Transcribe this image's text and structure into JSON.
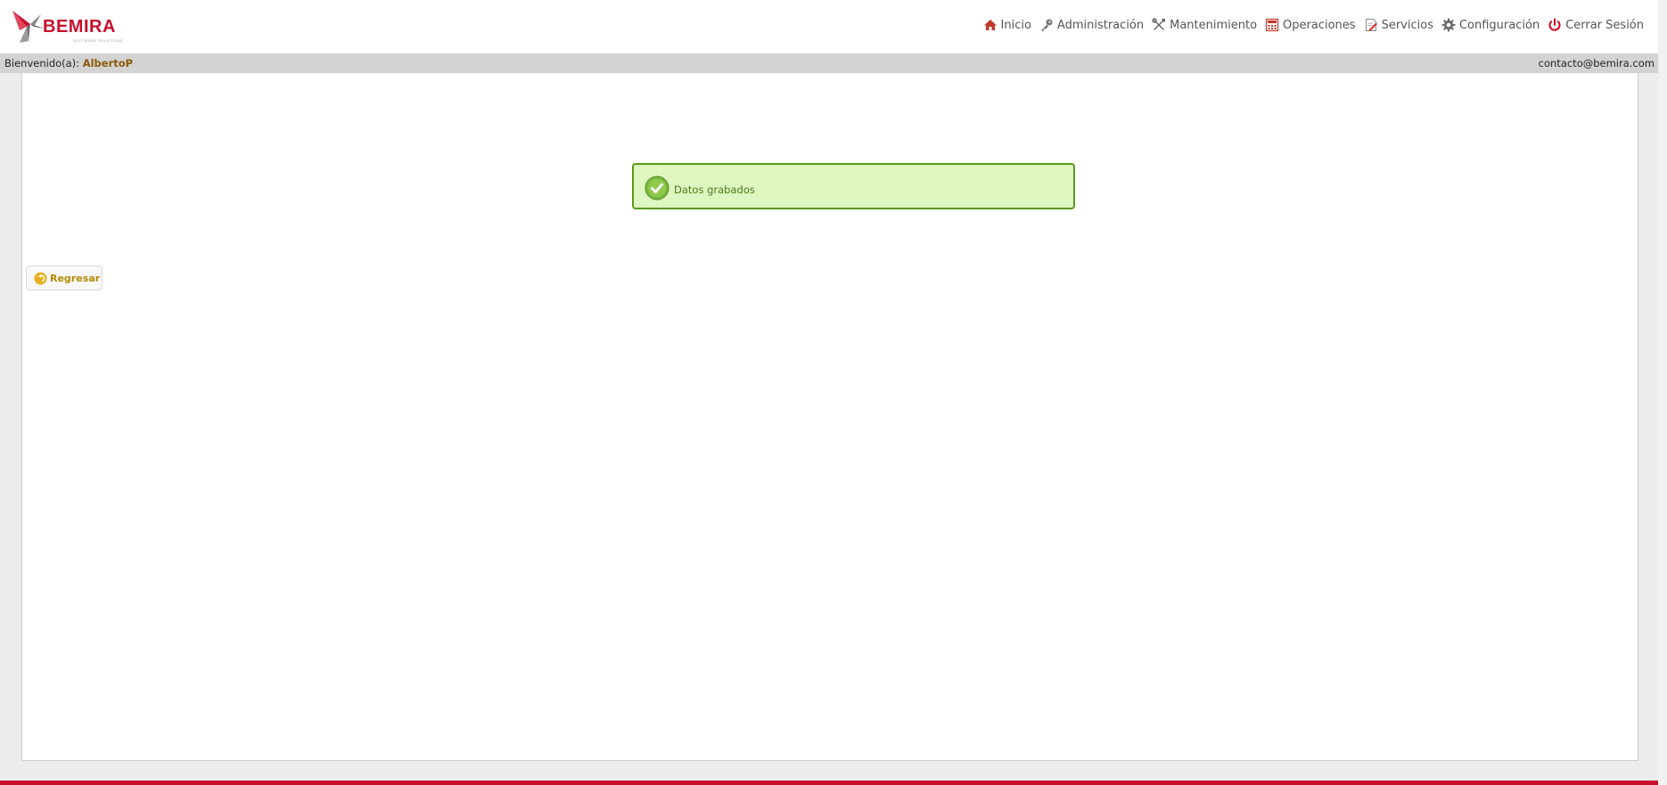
{
  "header": {
    "logo": {
      "text": "BEMIRA",
      "subtext": "SOFTWARE SOLUTIONS"
    },
    "nav": [
      {
        "label": "Inicio",
        "icon": "home-icon"
      },
      {
        "label": "Administración",
        "icon": "key-icon"
      },
      {
        "label": "Mantenimiento",
        "icon": "tools-icon"
      },
      {
        "label": "Operaciones",
        "icon": "calculator-icon"
      },
      {
        "label": "Servicios",
        "icon": "document-edit-icon"
      },
      {
        "label": "Configuración",
        "icon": "gear-icon"
      },
      {
        "label": "Cerrar Sesión",
        "icon": "power-icon"
      }
    ]
  },
  "userbar": {
    "welcome_label": "Bienvenido(a):",
    "username": "AlbertoP",
    "contact": "contacto@bemira.com"
  },
  "main": {
    "alert": {
      "message": "Datos grabados",
      "icon": "check-circle-icon"
    },
    "back_button": {
      "label": "Regresar",
      "icon": "back-arrow-icon"
    }
  },
  "colors": {
    "brand_red": "#c8102e",
    "success_bg": "#def6c0",
    "success_border": "#5a9a1a",
    "success_text": "#4b7c1b",
    "username": "#8b5a0a",
    "back_label": "#b48a00"
  }
}
